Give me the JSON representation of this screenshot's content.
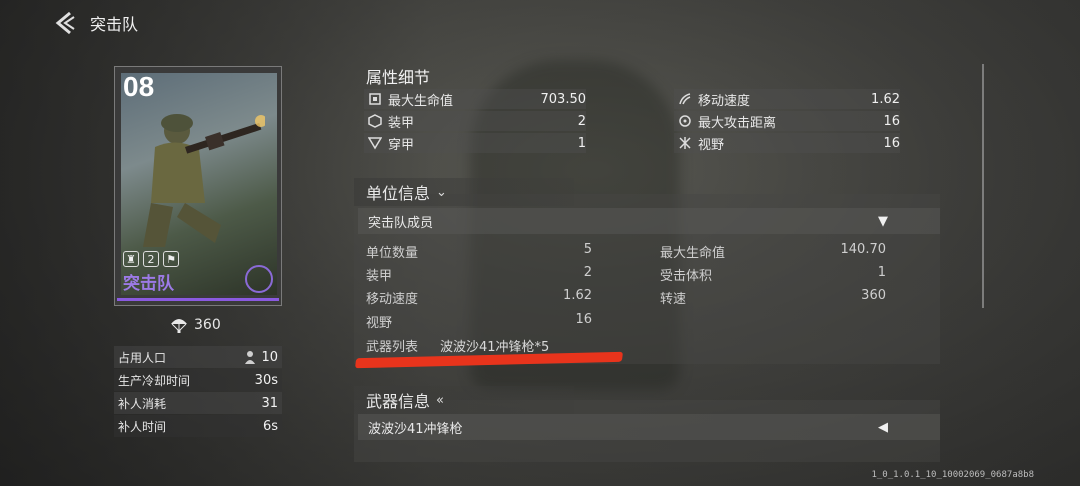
{
  "header": {
    "title": "突击队"
  },
  "card": {
    "number": "08",
    "name": "突击队",
    "badge_level": "2",
    "accent_color": "#9c7ae6"
  },
  "cost": {
    "value": "360",
    "icon": "parachute-icon"
  },
  "unit_stats": [
    {
      "label": "占用人口",
      "value": "10",
      "icon": "soldier-icon"
    },
    {
      "label": "生产冷却时间",
      "value": "30s"
    },
    {
      "label": "补人消耗",
      "value": "31"
    },
    {
      "label": "补人时间",
      "value": "6s"
    }
  ],
  "attributes": {
    "title": "属性细节",
    "left": [
      {
        "label": "最大生命值",
        "value": "703.50",
        "icon": "health-icon"
      },
      {
        "label": "装甲",
        "value": "2",
        "icon": "armor-icon"
      },
      {
        "label": "穿甲",
        "value": "1",
        "icon": "penetration-icon"
      }
    ],
    "right": [
      {
        "label": "移动速度",
        "value": "1.62",
        "icon": "speed-icon"
      },
      {
        "label": "最大攻击距离",
        "value": "16",
        "icon": "range-icon"
      },
      {
        "label": "视野",
        "value": "16",
        "icon": "vision-icon"
      }
    ]
  },
  "unit_info": {
    "title": "单位信息",
    "member_row": "突击队成员",
    "left": [
      {
        "label": "单位数量",
        "value": "5"
      },
      {
        "label": "装甲",
        "value": "2"
      },
      {
        "label": "移动速度",
        "value": "1.62"
      },
      {
        "label": "视野",
        "value": "16"
      }
    ],
    "right": [
      {
        "label": "最大生命值",
        "value": "140.70"
      },
      {
        "label": "受击体积",
        "value": "1"
      },
      {
        "label": "转速",
        "value": "360"
      }
    ],
    "weapons_label": "武器列表",
    "weapons_value": "波波沙41冲锋枪*5"
  },
  "weapon_info": {
    "title": "武器信息",
    "weapon_row": "波波沙41冲锋枪"
  },
  "version": "1_0_1.0.1_10_10002069_0687a8b8"
}
